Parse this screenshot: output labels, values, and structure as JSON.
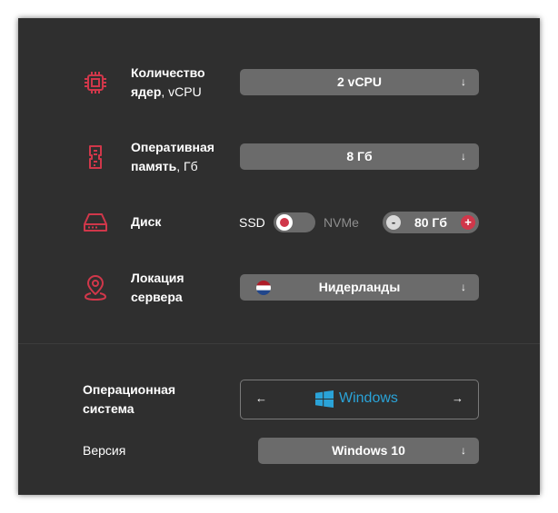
{
  "config": {
    "cpu": {
      "label_bold_1": "Количество",
      "label_bold_2": "ядер",
      "label_suffix": ", vCPU",
      "value": "2 vCPU",
      "icon": "cpu-icon"
    },
    "ram": {
      "label_bold_1": "Оперативная",
      "label_bold_2": "память",
      "label_suffix": ", Гб",
      "value": "8 Гб",
      "icon": "memory-icon"
    },
    "disk": {
      "label": "Диск",
      "type_left": "SSD",
      "type_right": "NVMe",
      "selected_type": "SSD",
      "size": "80 Гб",
      "minus": "-",
      "plus": "+",
      "icon": "disk-icon"
    },
    "location": {
      "label_1": "Локация",
      "label_2": "сервера",
      "value": "Нидерланды",
      "flag": "netherlands-flag",
      "icon": "location-pin-icon"
    }
  },
  "os": {
    "label_1": "Операционная",
    "label_2": "система",
    "value": "Windows",
    "prev": "←",
    "next": "→",
    "version_label": "Версия",
    "version_value": "Windows 10"
  },
  "dropdown_arrow": "↓",
  "colors": {
    "panel": "#2f2f2f",
    "control": "#6b6b6b",
    "accent": "#d0374a",
    "windows": "#2aa3d8"
  }
}
